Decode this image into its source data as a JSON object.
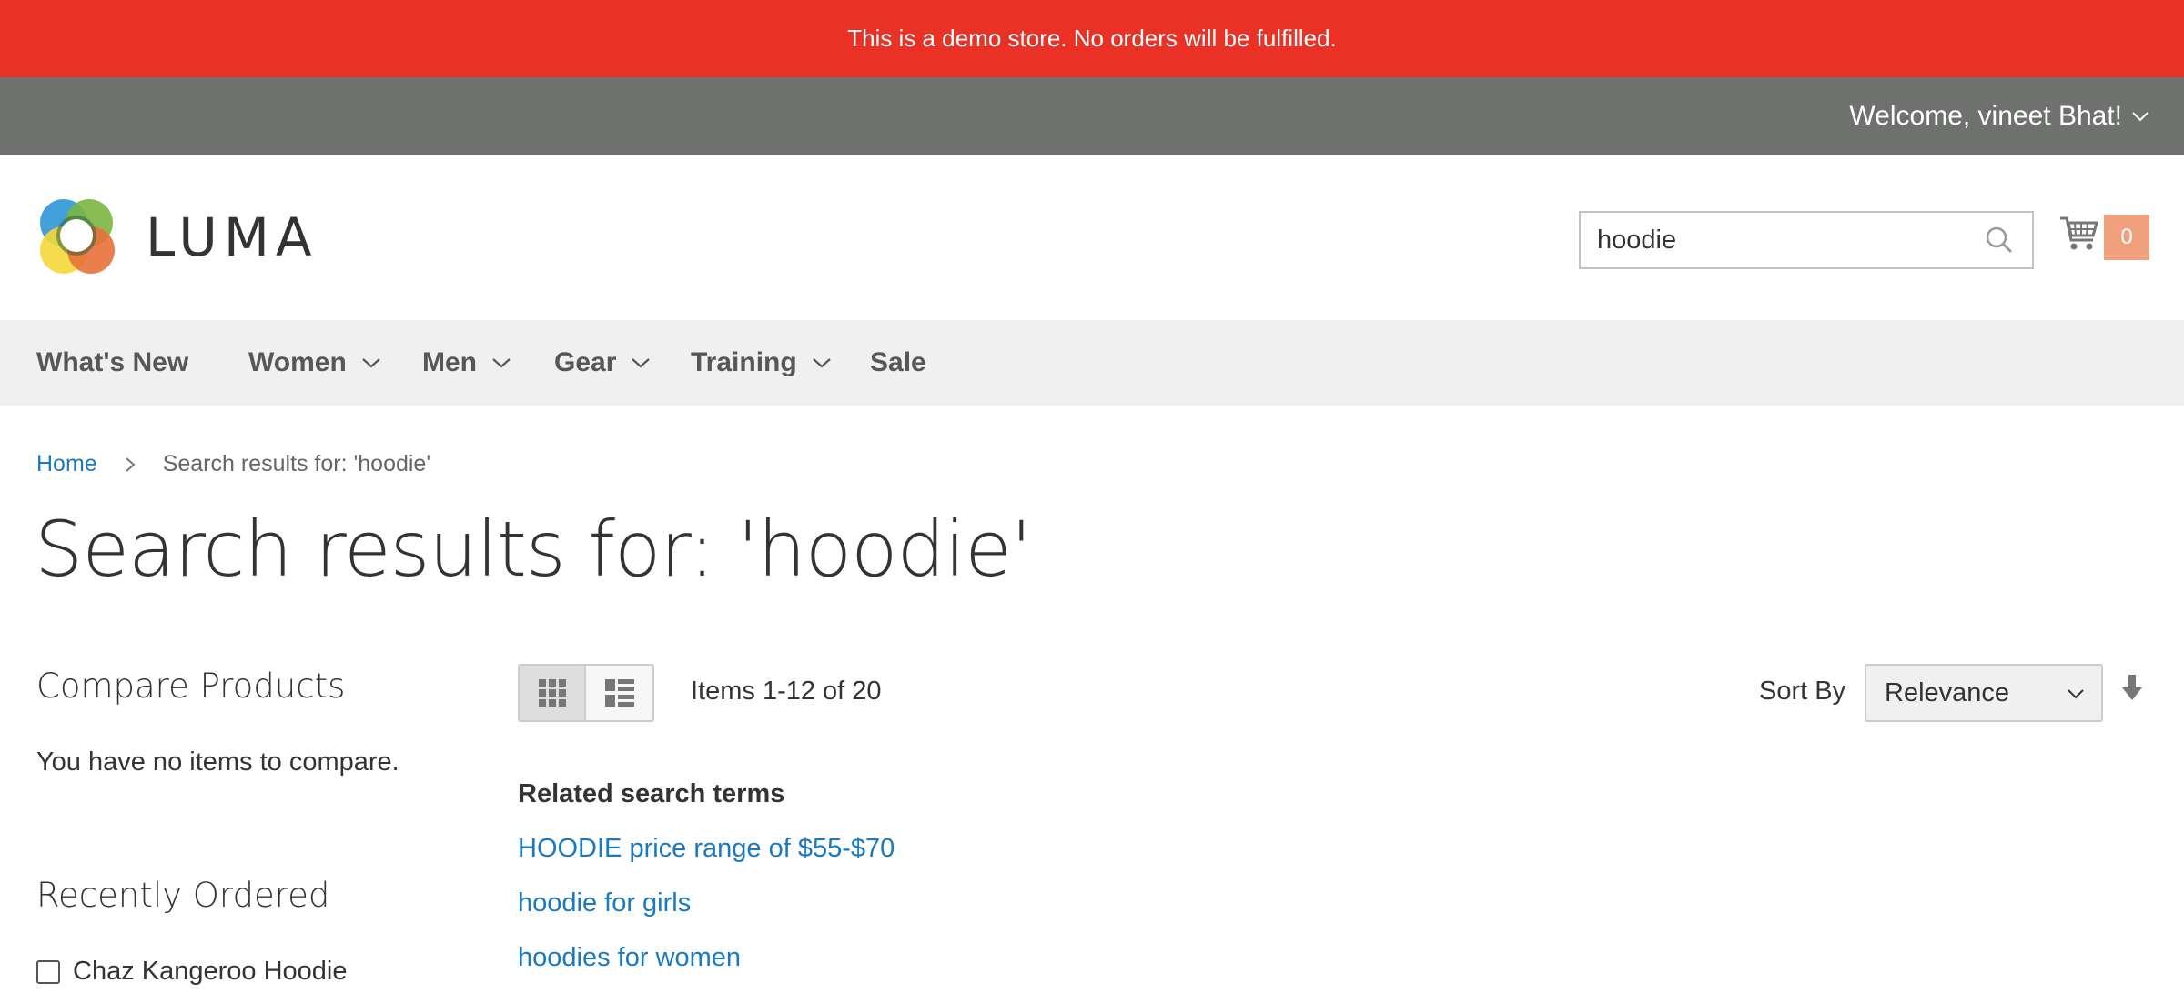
{
  "demo_notice": "This is a demo store. No orders will be fulfilled.",
  "header": {
    "welcome": "Welcome, vineet Bhat!",
    "logo_text": "LUMA",
    "search": {
      "value": "hoodie"
    },
    "cart": {
      "count": "0"
    }
  },
  "nav": {
    "items": [
      {
        "label": "What's New"
      },
      {
        "label": "Women"
      },
      {
        "label": "Men"
      },
      {
        "label": "Gear"
      },
      {
        "label": "Training"
      },
      {
        "label": "Sale"
      }
    ]
  },
  "breadcrumb": {
    "home": "Home",
    "current": "Search results for: 'hoodie'"
  },
  "page_title": "Search results for: 'hoodie'",
  "sidebar": {
    "compare": {
      "title": "Compare Products",
      "empty": "You have no items to compare."
    },
    "recently_ordered": {
      "title": "Recently Ordered",
      "items": [
        {
          "label": "Chaz Kangeroo Hoodie",
          "checked": false
        }
      ]
    }
  },
  "toolbar": {
    "amount": "Items 1-12 of 20",
    "sort_label": "Sort By",
    "sort_value": "Relevance",
    "view_modes": [
      "grid",
      "list"
    ],
    "active_view": "grid"
  },
  "related": {
    "title": "Related search terms",
    "terms": [
      "HOODIE price range of $55-$70",
      "hoodie for girls",
      "hoodies for women"
    ]
  },
  "colors": {
    "demo_bar": "#e93225",
    "welcome_bar": "#6e716e",
    "link": "#1979c3",
    "nav_bg": "#f0f0f0"
  }
}
